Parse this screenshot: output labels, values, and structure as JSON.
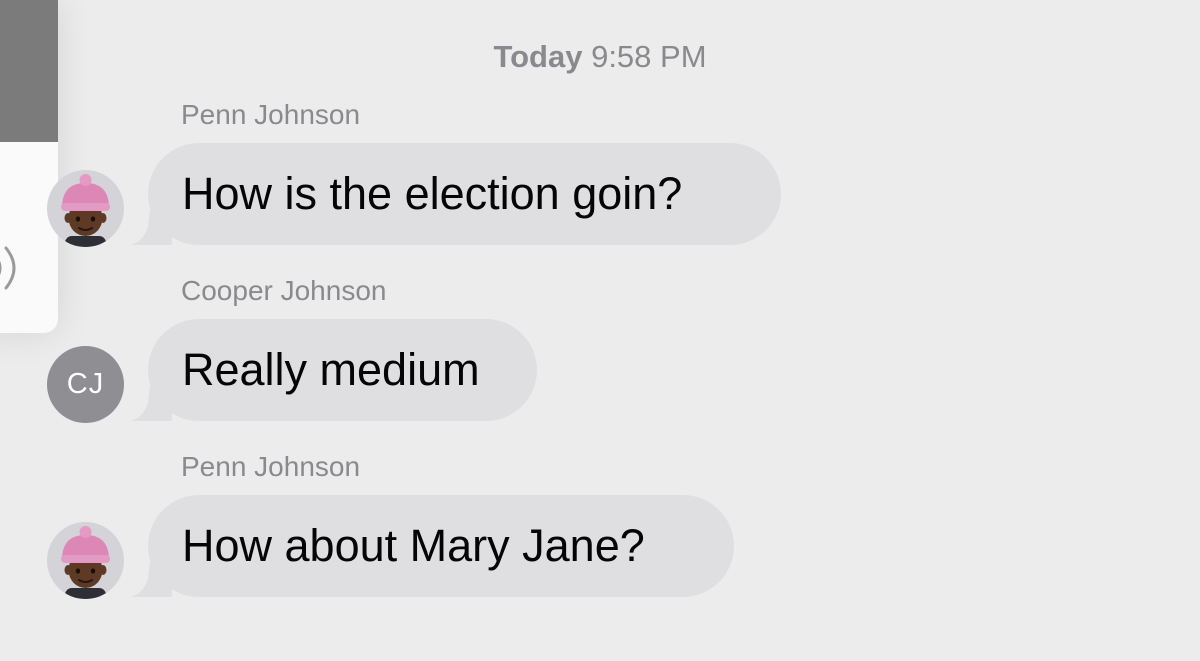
{
  "conversation": {
    "timestamp": {
      "day": "Today",
      "time": "9:58 PM"
    },
    "messages": [
      {
        "sender": "Penn Johnson",
        "text": "How is the election goin?",
        "avatar_type": "memoji"
      },
      {
        "sender": "Cooper Johnson",
        "text": "Really medium",
        "avatar_type": "initials",
        "avatar_initials": "CJ"
      },
      {
        "sender": "Penn Johnson",
        "text": "How about Mary Jane?",
        "avatar_type": "memoji"
      }
    ]
  },
  "side_panel": {
    "icon": "airplay-audio-icon"
  },
  "colors": {
    "background": "#ececec",
    "bubble": "#dfdfe2",
    "meta_text": "#8a8a8e",
    "avatar_initials_bg": "#8e8e93"
  }
}
